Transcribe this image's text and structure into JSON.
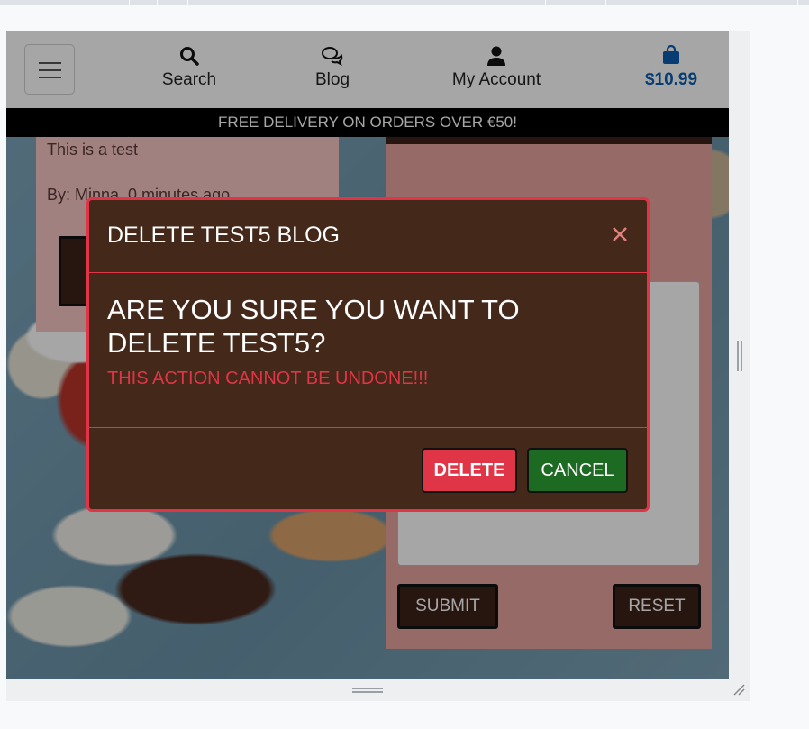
{
  "navbar": {
    "menu_icon": "hamburger-icon",
    "search_label": "Search",
    "blog_label": "Blog",
    "account_label": "My Account",
    "cart_total": "$10.99",
    "cart_color": "#0d5fb3"
  },
  "banner": {
    "text": "FREE DELIVERY ON ORDERS OVER €50!"
  },
  "blog_card": {
    "body": "This is a test",
    "byline": "By: Minna, 0 minutes ago"
  },
  "form": {
    "submit_label": "SUBMIT",
    "reset_label": "RESET"
  },
  "modal": {
    "title": "DELETE TEST5 BLOG",
    "question": "ARE YOU SURE YOU WANT TO DELETE TEST5?",
    "warning": "THIS ACTION CANNOT BE UNDONE!!!",
    "delete_label": "DELETE",
    "cancel_label": "CANCEL",
    "accent_color": "#e03546",
    "cancel_color": "#1d6b22",
    "background_color": "#44281a"
  }
}
